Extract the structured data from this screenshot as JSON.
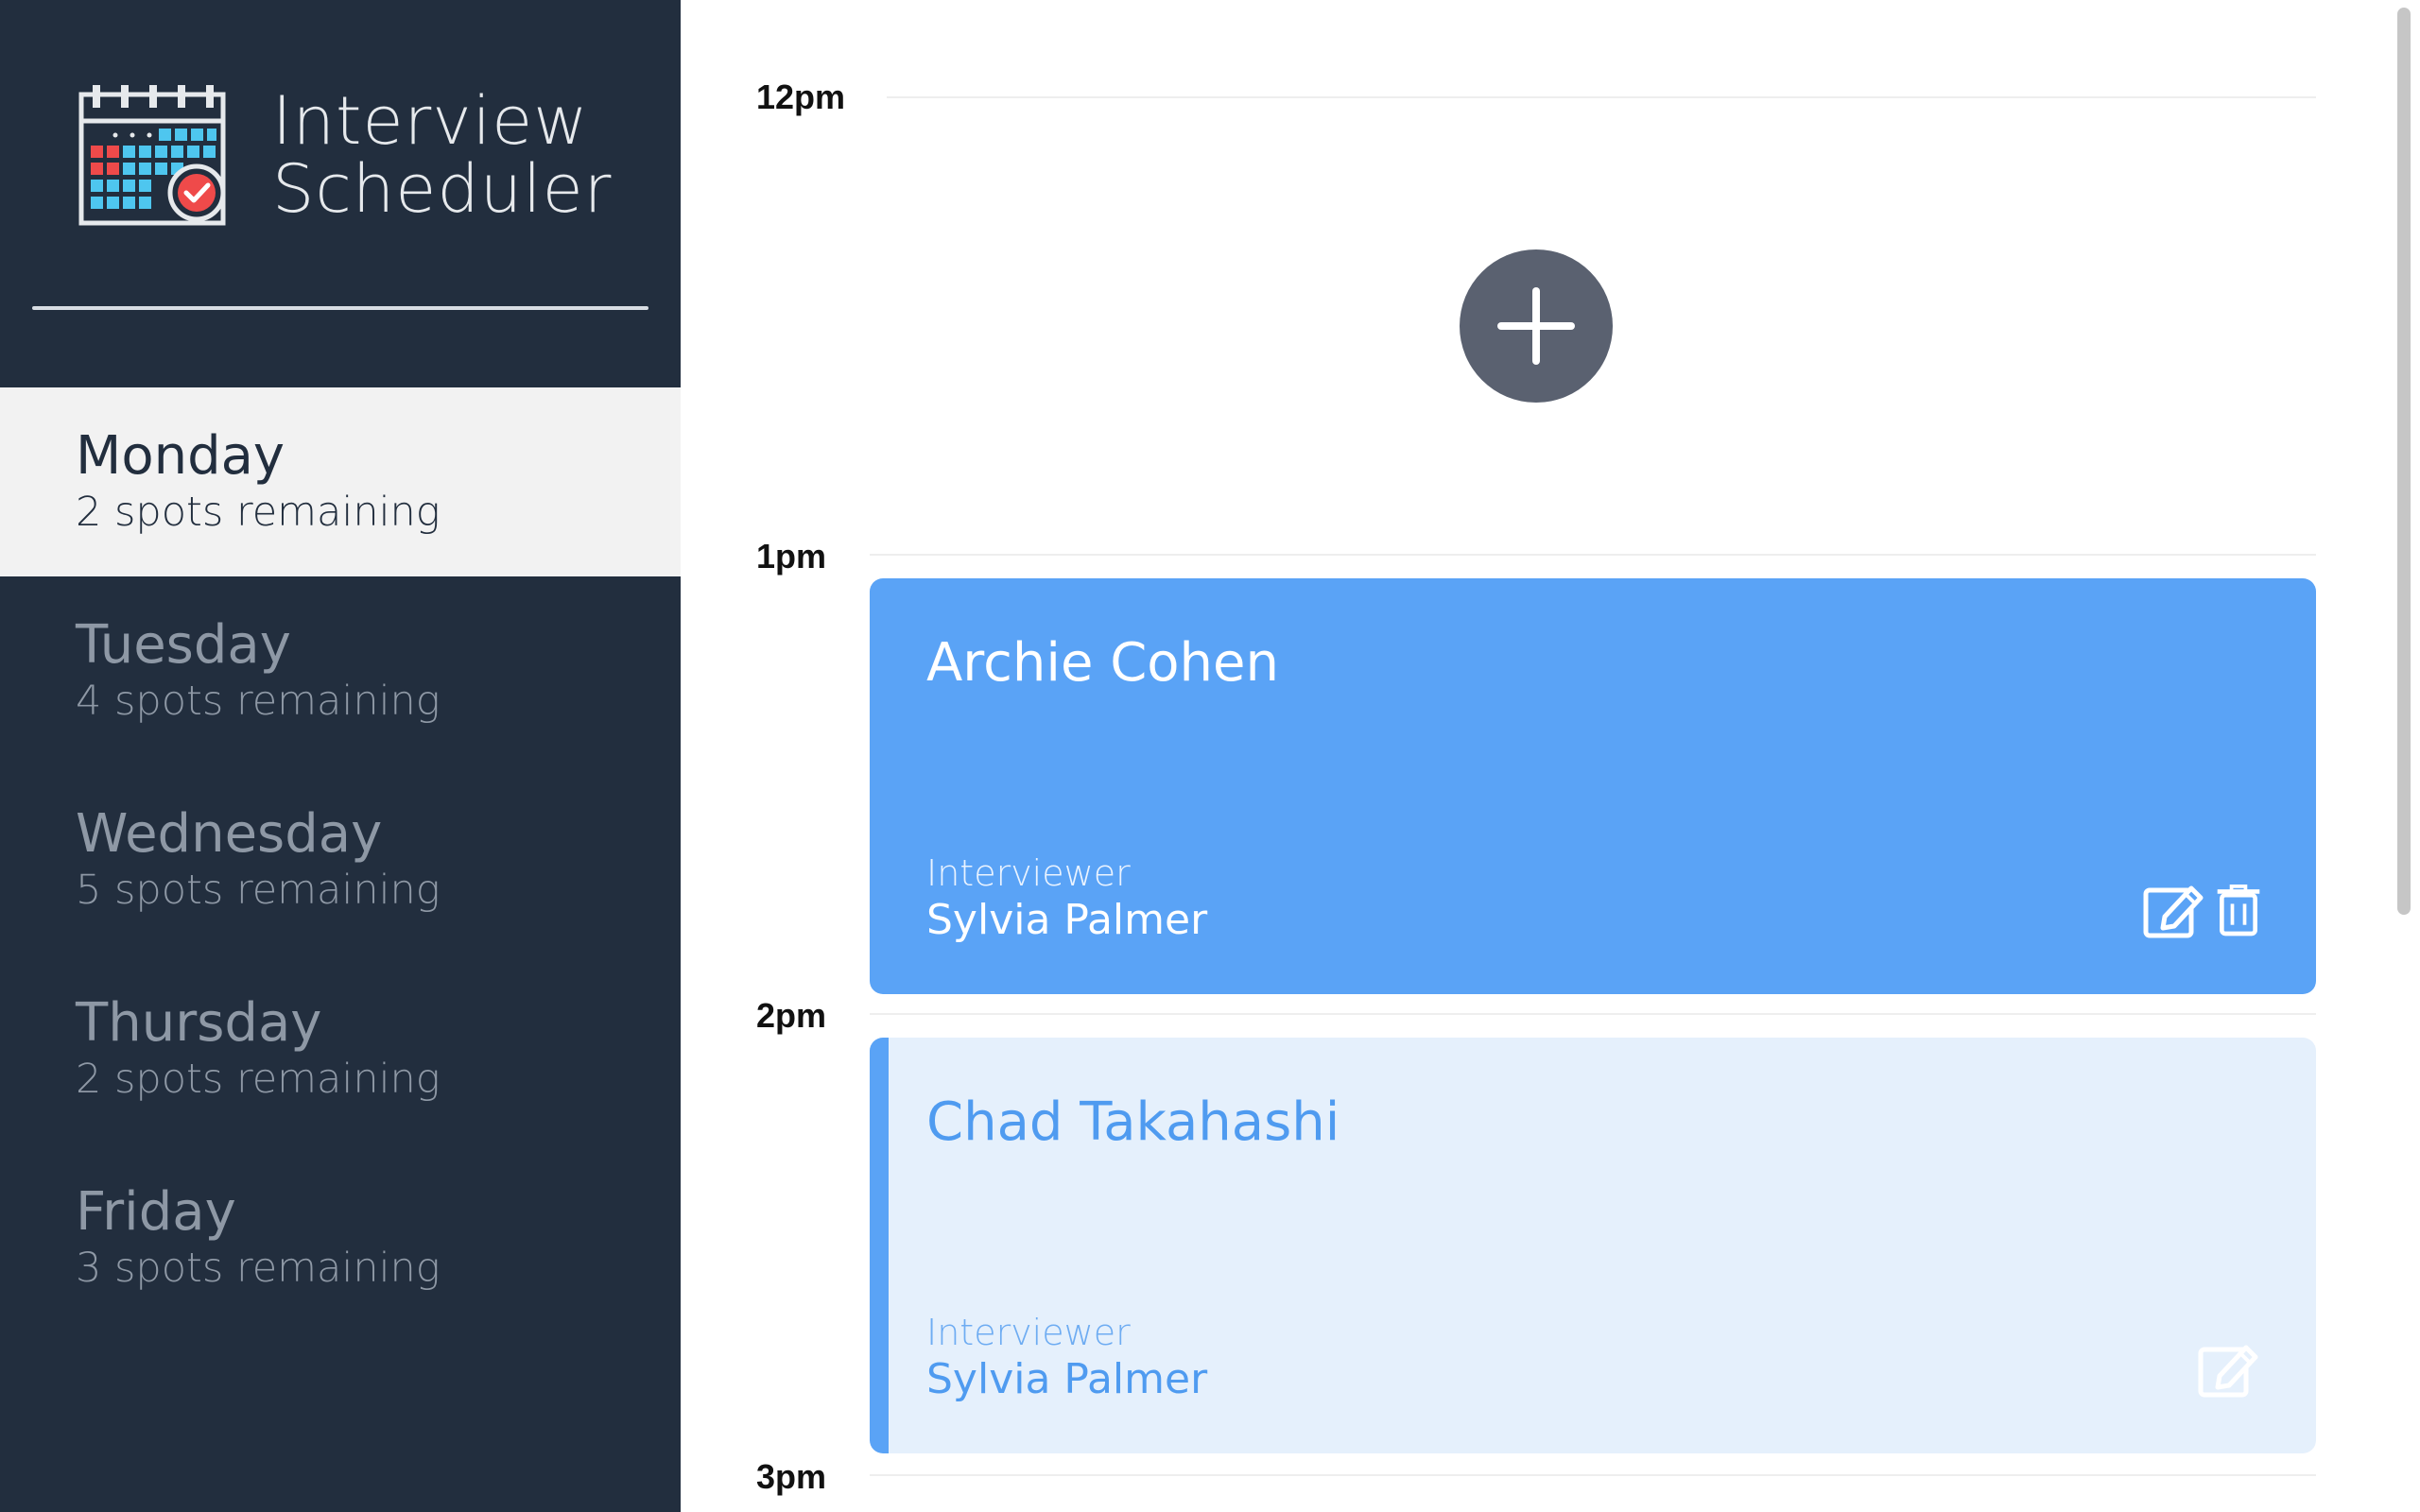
{
  "app": {
    "title_line1": "Interview",
    "title_line2": "Scheduler"
  },
  "days": [
    {
      "name": "Monday",
      "spots": "2 spots remaining",
      "selected": true
    },
    {
      "name": "Tuesday",
      "spots": "4 spots remaining",
      "selected": false
    },
    {
      "name": "Wednesday",
      "spots": "5 spots remaining",
      "selected": false
    },
    {
      "name": "Thursday",
      "spots": "2 spots remaining",
      "selected": false
    },
    {
      "name": "Friday",
      "spots": "3 spots remaining",
      "selected": false
    }
  ],
  "times": [
    "12pm",
    "1pm",
    "2pm",
    "3pm"
  ],
  "appointments": [
    {
      "student": "Archie Cohen",
      "interviewer_label": "Interviewer",
      "interviewer": "Sylvia Palmer"
    },
    {
      "student": "Chad Takahashi",
      "interviewer_label": "Interviewer",
      "interviewer": "Sylvia Palmer"
    }
  ],
  "colors": {
    "sidebar": "#222e3e",
    "accent": "#5aa3f6",
    "appointment_light": "#e5f0fc",
    "add_button": "#5a6170"
  },
  "icons": {
    "add": "plus-icon",
    "edit": "edit-icon",
    "delete": "trash-icon"
  }
}
